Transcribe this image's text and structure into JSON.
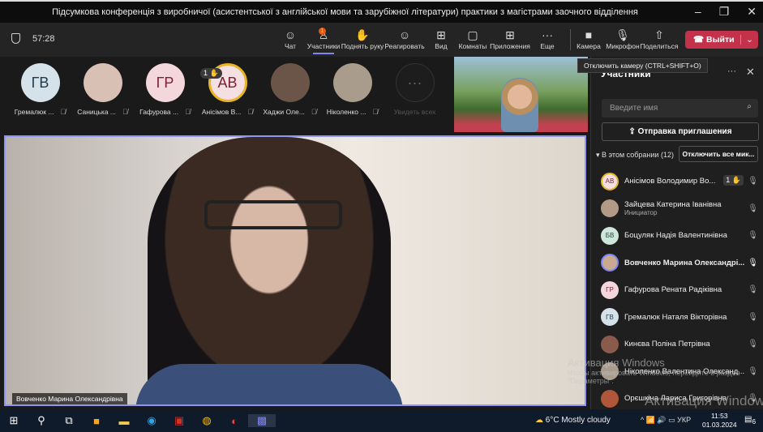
{
  "window": {
    "title": "Підсумкова конференція з виробничої (асистентської з англійської мови та зарубіжної літератури) практики з магістрами заочного відділення"
  },
  "toolbar": {
    "timer": "57:28",
    "participants_badge": "1",
    "items": [
      {
        "label": "Чат",
        "icon": "chat-icon"
      },
      {
        "label": "Участники",
        "icon": "people-icon"
      },
      {
        "label": "Поднять руку",
        "icon": "hand-icon"
      },
      {
        "label": "Реагировать",
        "icon": "smile-icon"
      },
      {
        "label": "Вид",
        "icon": "grid-icon"
      },
      {
        "label": "Комнаты",
        "icon": "rooms-icon"
      },
      {
        "label": "Приложения",
        "icon": "plus-icon"
      },
      {
        "label": "Еще",
        "icon": "more-icon"
      },
      {
        "label": "Камера",
        "icon": "camera-icon"
      },
      {
        "label": "Микрофон",
        "icon": "mic-off-icon"
      },
      {
        "label": "Поделиться",
        "icon": "share-icon"
      }
    ],
    "leave": "Выйти"
  },
  "tooltip": "Отключить камеру (CTRL+SHIFT+O)",
  "gallery": [
    {
      "initials": "ГВ",
      "name": "Гремалюк ...",
      "bg": "#d6e2ea",
      "fg": "#1d3a4c"
    },
    {
      "initials": "",
      "name": "Саницька ...",
      "bg": "#d9c0b4",
      "fg": "#333"
    },
    {
      "initials": "ГР",
      "name": "Гафурова ...",
      "bg": "#f4d7dd",
      "fg": "#7d2035"
    },
    {
      "initials": "АВ",
      "name": "Анісімов В...",
      "bg": "#f4dfe2",
      "fg": "#7d2035",
      "hand": "1"
    },
    {
      "initials": "",
      "name": "Хаджи Оле...",
      "bg": "#6b5448",
      "fg": "#333"
    },
    {
      "initials": "",
      "name": "Ніколенко ...",
      "bg": "#a99c8c",
      "fg": "#333"
    },
    {
      "initials": "···",
      "name": "Увидеть всех",
      "bg": "#1d1d1d",
      "fg": "#666"
    }
  ],
  "main_video": {
    "name": "Вовченко Марина Олександрівна"
  },
  "panel": {
    "title": "Участники",
    "search_placeholder": "Введите имя",
    "invite": "Отправка приглашения",
    "section": "В этом собрании (12)",
    "mute_all": "Отключить все мик...",
    "people": [
      {
        "initials": "АВ",
        "name": "Анісімов Володимир Во...",
        "bg": "#f4dfe2",
        "fg": "#7d2035",
        "hand": "1",
        "mic": "off"
      },
      {
        "initials": "",
        "name": "Зайцева Катерина Іванівна",
        "role": "Инициатор",
        "bg": "#b39a86",
        "fg": "#333",
        "mic": "off"
      },
      {
        "initials": "БВ",
        "name": "Боцуляк Надія Валентинівна",
        "bg": "#cfe6dd",
        "fg": "#1d4c3a",
        "mic": "off"
      },
      {
        "initials": "",
        "name": "Вовченко Марина Олександрі...",
        "bg": "#c9a990",
        "fg": "#333",
        "mic": "on"
      },
      {
        "initials": "ГР",
        "name": "Гафурова Рената Радіківна",
        "bg": "#f4d7dd",
        "fg": "#7d2035",
        "mic": "off"
      },
      {
        "initials": "ГВ",
        "name": "Гремалюк Наталя Вікторівна",
        "bg": "#d6e2ea",
        "fg": "#1d3a4c",
        "mic": "off"
      },
      {
        "initials": "",
        "name": "Кинєва Поліна Петрівна",
        "bg": "#8a5a4a",
        "fg": "#333",
        "mic": "off"
      },
      {
        "initials": "",
        "name": "Ніколенко Валентина Олександ...",
        "bg": "#a99c8c",
        "fg": "#333",
        "mic": "off"
      },
      {
        "initials": "",
        "name": "Орєшкіна Лариса Григорівна",
        "bg": "#b0563a",
        "fg": "#333",
        "mic": "off"
      }
    ]
  },
  "watermark": {
    "title": "Активация Windows",
    "text": "Чтобы активировать Windows, перейдите в раздел \"Параметры\".",
    "big": "Активация Windows"
  },
  "taskbar": {
    "weather": "6°C  Mostly cloudy",
    "lang": "УКР",
    "time": "11:53",
    "date": "01.03.2024",
    "notifications": "6"
  }
}
